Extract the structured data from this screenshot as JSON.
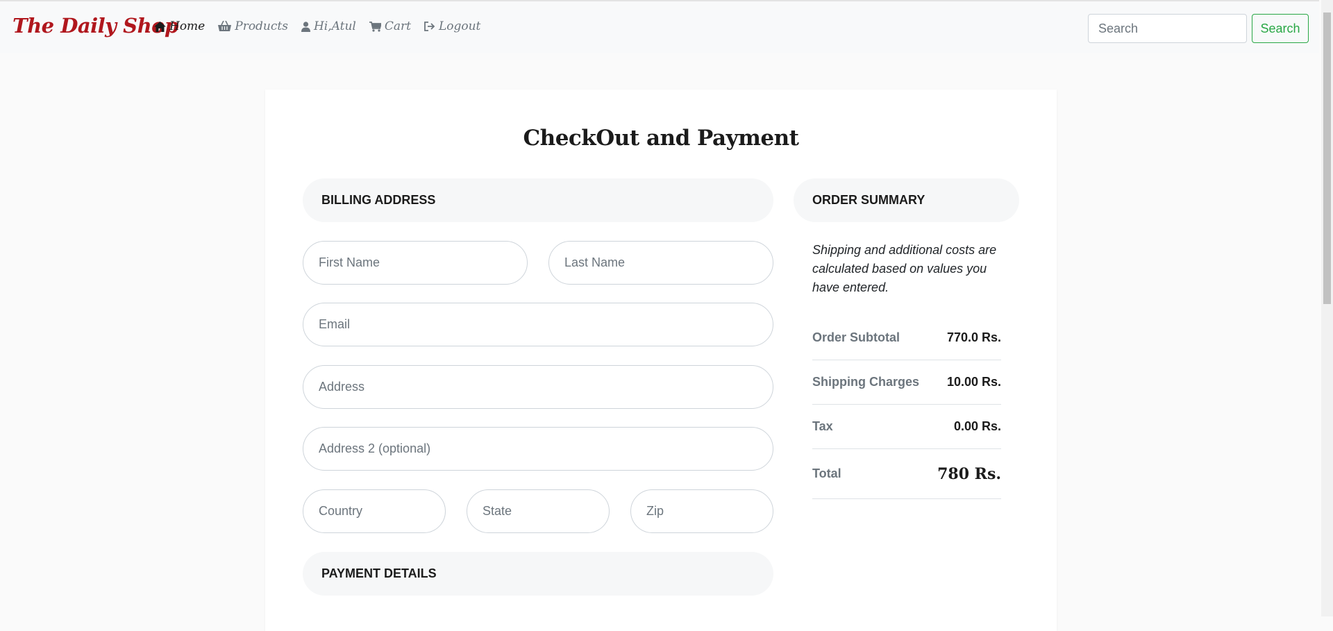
{
  "nav": {
    "brand": "The Daily Shop",
    "items": [
      {
        "label": "Home",
        "icon": "home-icon",
        "active": true
      },
      {
        "label": "Products",
        "icon": "basket-icon",
        "active": false
      },
      {
        "label": "Hi,Atul",
        "icon": "user-icon",
        "active": false
      },
      {
        "label": "Cart",
        "icon": "cart-icon",
        "active": false
      },
      {
        "label": "Logout",
        "icon": "logout-icon",
        "active": false
      }
    ],
    "search_placeholder": "Search",
    "search_button": "Search"
  },
  "page": {
    "title": "CheckOut and Payment"
  },
  "billing": {
    "header": "BILLING ADDRESS",
    "first_name_placeholder": "First Name",
    "last_name_placeholder": "Last Name",
    "email_placeholder": "Email",
    "address_placeholder": "Address",
    "address2_placeholder": "Address 2 (optional)",
    "country_placeholder": "Country",
    "state_placeholder": "State",
    "zip_placeholder": "Zip"
  },
  "payment": {
    "header": "PAYMENT DETAILS"
  },
  "summary": {
    "header": "ORDER SUMMARY",
    "note": "Shipping and additional costs are calculated based on values you have entered.",
    "rows": [
      {
        "label": "Order Subtotal",
        "value": "770.0 Rs."
      },
      {
        "label": "Shipping Charges",
        "value": "10.00 Rs."
      },
      {
        "label": "Tax",
        "value": "0.00 Rs."
      }
    ],
    "total_label": "Total",
    "total_value": "780 Rs."
  },
  "colors": {
    "brand": "#b0171d",
    "search_button": "#28a745",
    "header_bg": "#f6f7f8"
  }
}
